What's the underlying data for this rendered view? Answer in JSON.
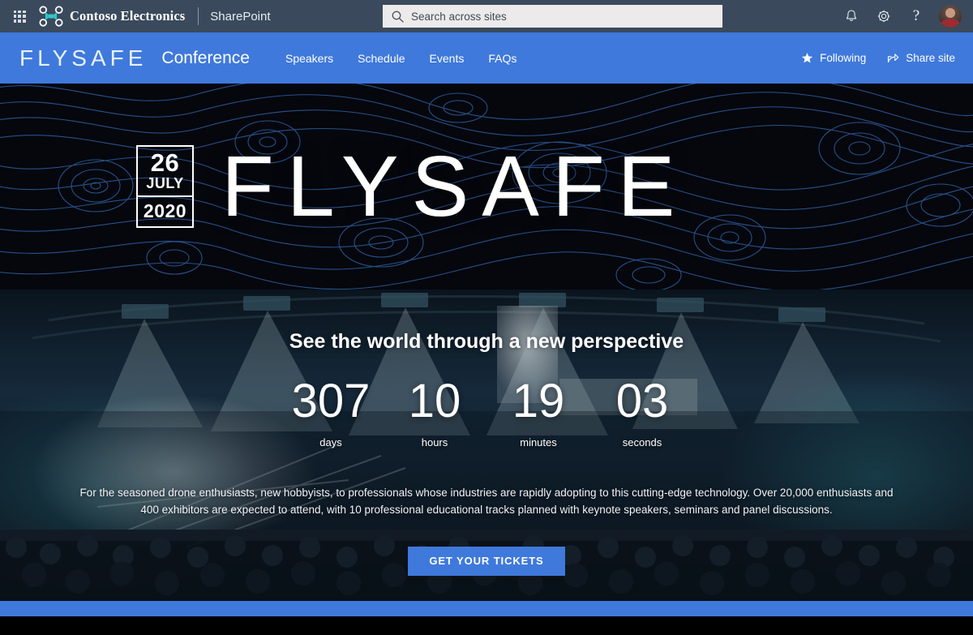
{
  "suite_bar": {
    "waffle_label": "App launcher",
    "brand_name": "Contoso Electronics",
    "app_name": "SharePoint",
    "logo_icon": "drone-icon",
    "search": {
      "placeholder": "Search across sites",
      "value": "",
      "icon": "search-icon"
    },
    "actions": [
      {
        "name": "notifications",
        "icon": "bell-icon"
      },
      {
        "name": "settings",
        "icon": "gear-icon"
      },
      {
        "name": "help",
        "icon": "question-mark-icon",
        "glyph": "?"
      }
    ],
    "avatar_label": "User avatar"
  },
  "site_nav": {
    "site_logo": "FLYSAFE",
    "site_title": "Conference",
    "links": [
      {
        "label": "Speakers"
      },
      {
        "label": "Schedule"
      },
      {
        "label": "Events"
      },
      {
        "label": "FAQs"
      }
    ],
    "following_label": "Following",
    "following_icon": "star-icon",
    "share_label": "Share site",
    "share_icon": "share-icon"
  },
  "banner": {
    "date_day": "26",
    "date_month": "JULY",
    "date_year": "2020",
    "wordmark": "FLYSAFE",
    "background": "topographic-contour-pattern"
  },
  "hero": {
    "headline": "See the world through a new perspective",
    "countdown": [
      {
        "value": "307",
        "label": "days"
      },
      {
        "value": "10",
        "label": "hours"
      },
      {
        "value": "19",
        "label": "minutes"
      },
      {
        "value": "03",
        "label": "seconds"
      }
    ],
    "description": "For the seasoned drone enthusiasts, new hobbyists, to professionals whose industries are rapidly adopting to this cutting-edge technology. Over 20,000 enthusiasts and 400 exhibitors are expected to attend, with 10 professional educational tracks planned with keynote speakers, seminars and panel discussions.",
    "cta_label": "GET YOUR TICKETS",
    "background": "conference-arena-photo"
  },
  "colors": {
    "suite_bar": "#3a4a5c",
    "accent_blue": "#3f79db",
    "banner_dark": "#05070d",
    "logo_teal": "#31c5c7",
    "search_bg": "#eceaea"
  }
}
